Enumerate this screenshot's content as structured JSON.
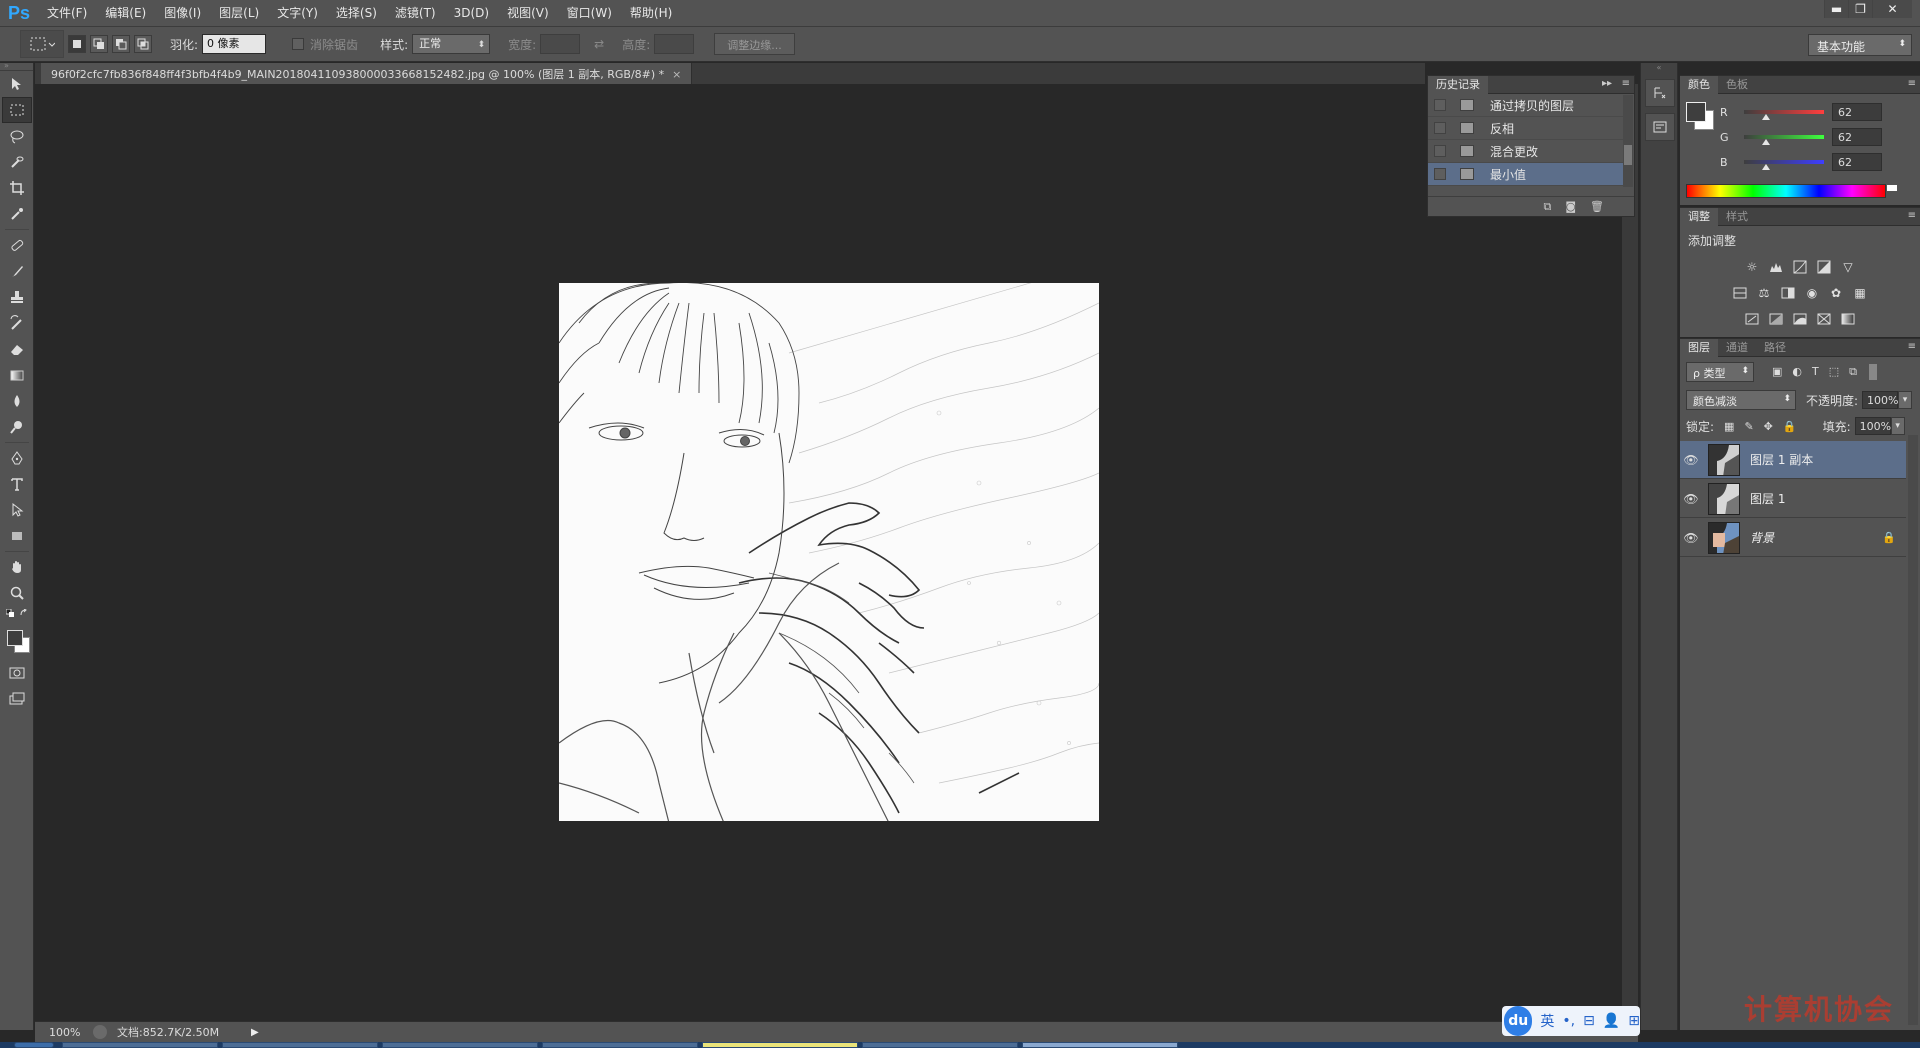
{
  "app": {
    "logo": "Ps"
  },
  "menu": [
    "文件(F)",
    "编辑(E)",
    "图像(I)",
    "图层(L)",
    "文字(Y)",
    "选择(S)",
    "滤镜(T)",
    "3D(D)",
    "视图(V)",
    "窗口(W)",
    "帮助(H)"
  ],
  "window_controls": {
    "minimize": "▬",
    "restore": "❐",
    "close": "✕"
  },
  "options": {
    "feather_label": "羽化:",
    "feather_value": "0 像素",
    "antialias_label": "消除锯齿",
    "style_label": "样式:",
    "style_value": "正常",
    "width_label": "宽度:",
    "height_label": "高度:",
    "refine_button": "调整边缘...",
    "workspace": "基本功能"
  },
  "document": {
    "tab_title": "96f0f2cfc7fb836f848ff4f3bfb4f4b9_MAIN201804110938000033668152482.jpg @ 100% (图层 1 副本, RGB/8#) *",
    "close": "×"
  },
  "status": {
    "zoom": "100%",
    "doc_size": "文档:852.7K/2.50M",
    "arrow": "▶"
  },
  "history": {
    "tab": "历史记录",
    "items": [
      {
        "label": "通过拷贝的图层",
        "selected": false
      },
      {
        "label": "反相",
        "selected": false
      },
      {
        "label": "混合更改",
        "selected": false
      },
      {
        "label": "最小值",
        "selected": true
      }
    ]
  },
  "color_panel": {
    "tabs": [
      "颜色",
      "色板"
    ],
    "r_label": "R",
    "g_label": "G",
    "b_label": "B",
    "r": "62",
    "g": "62",
    "b": "62",
    "fg_color": "#3e3e3e",
    "bg_color": "#ffffff"
  },
  "adjust_panel": {
    "tabs": [
      "调整",
      "样式"
    ],
    "title": "添加调整"
  },
  "layers_panel": {
    "tabs": [
      "图层",
      "通道",
      "路径"
    ],
    "filter_kind": "ρ 类型",
    "blend_mode": "颜色减淡",
    "opacity_label": "不透明度:",
    "opacity": "100%",
    "lock_label": "锁定:",
    "fill_label": "填充:",
    "fill": "100%",
    "layers": [
      {
        "name": "图层 1 副本",
        "selected": true
      },
      {
        "name": "图层 1",
        "selected": false
      },
      {
        "name": "背景",
        "selected": false,
        "locked": true
      }
    ]
  },
  "ime": {
    "logo": "du",
    "lang": "英"
  },
  "watermark": "计算机协会",
  "colors": {
    "accent_selection": "#5c6e8a",
    "ps_blue": "#31a8ff",
    "panel": "#535353",
    "canvas_bg": "#282828"
  }
}
